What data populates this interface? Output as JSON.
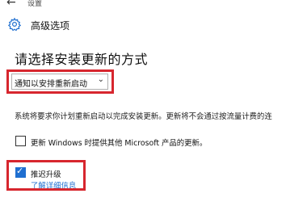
{
  "topbar": {
    "back_glyph": "←",
    "settings_label": "设置"
  },
  "header": {
    "icon": "gear-icon",
    "title": "高级选项"
  },
  "install_section": {
    "title": "请选择安装更新的方式",
    "dropdown_value": "通知以安排重新启动",
    "chevron": "⌄",
    "description": "系统将要求你计划重新启动以完成安装更新。更新将不会通过按流量计费的连"
  },
  "options": {
    "other_products": {
      "label": "更新 Windows 时提供其他 Microsoft 产品的更新。",
      "checked": false
    },
    "defer_upgrades": {
      "label": "推迟升级",
      "checked": true,
      "check_glyph": "✓",
      "link": "了解详细信息"
    }
  },
  "colors": {
    "accent": "#1f6fd0",
    "highlight_box": "#d7262e"
  }
}
